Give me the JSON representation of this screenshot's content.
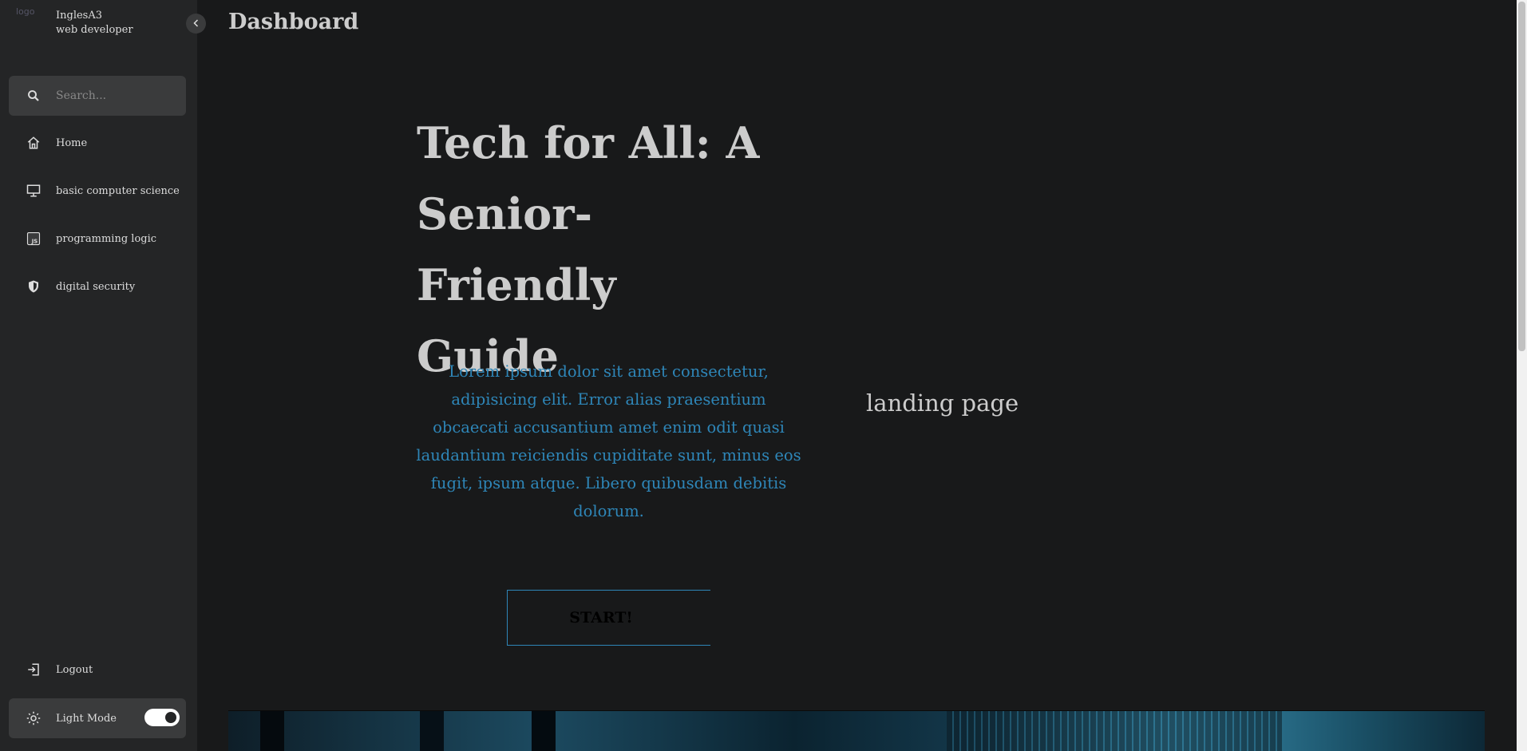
{
  "sidebar": {
    "logo_alt": "logo",
    "brand_name": "InglesA3",
    "brand_role": "web developer",
    "search_placeholder": "Search...",
    "items": [
      {
        "label": "Home",
        "icon": "home-icon"
      },
      {
        "label": "basic computer science",
        "icon": "monitor-icon"
      },
      {
        "label": "programming logic",
        "icon": "js-icon"
      },
      {
        "label": "digital security",
        "icon": "shield-icon"
      }
    ],
    "logout_label": "Logout",
    "mode_label": "Light Mode",
    "mode_toggle_on": true
  },
  "main": {
    "page_title": "Dashboard",
    "hero_title": "Tech for All: A Senior-Friendly Guide",
    "hero_text": "Lorem ipsum dolor sit amet consectetur, adipisicing elit. Error alias praesentium obcaecati accusantium amet enim odit quasi laudantium reiciendis cupiditate sunt, minus eos fugit, ipsum atque. Libero quibusdam debitis dolorum.",
    "start_label": "START!",
    "landing_alt": "landing page"
  },
  "colors": {
    "background": "#18191a",
    "sidebar": "#242526",
    "accent": "#2e86b8"
  }
}
